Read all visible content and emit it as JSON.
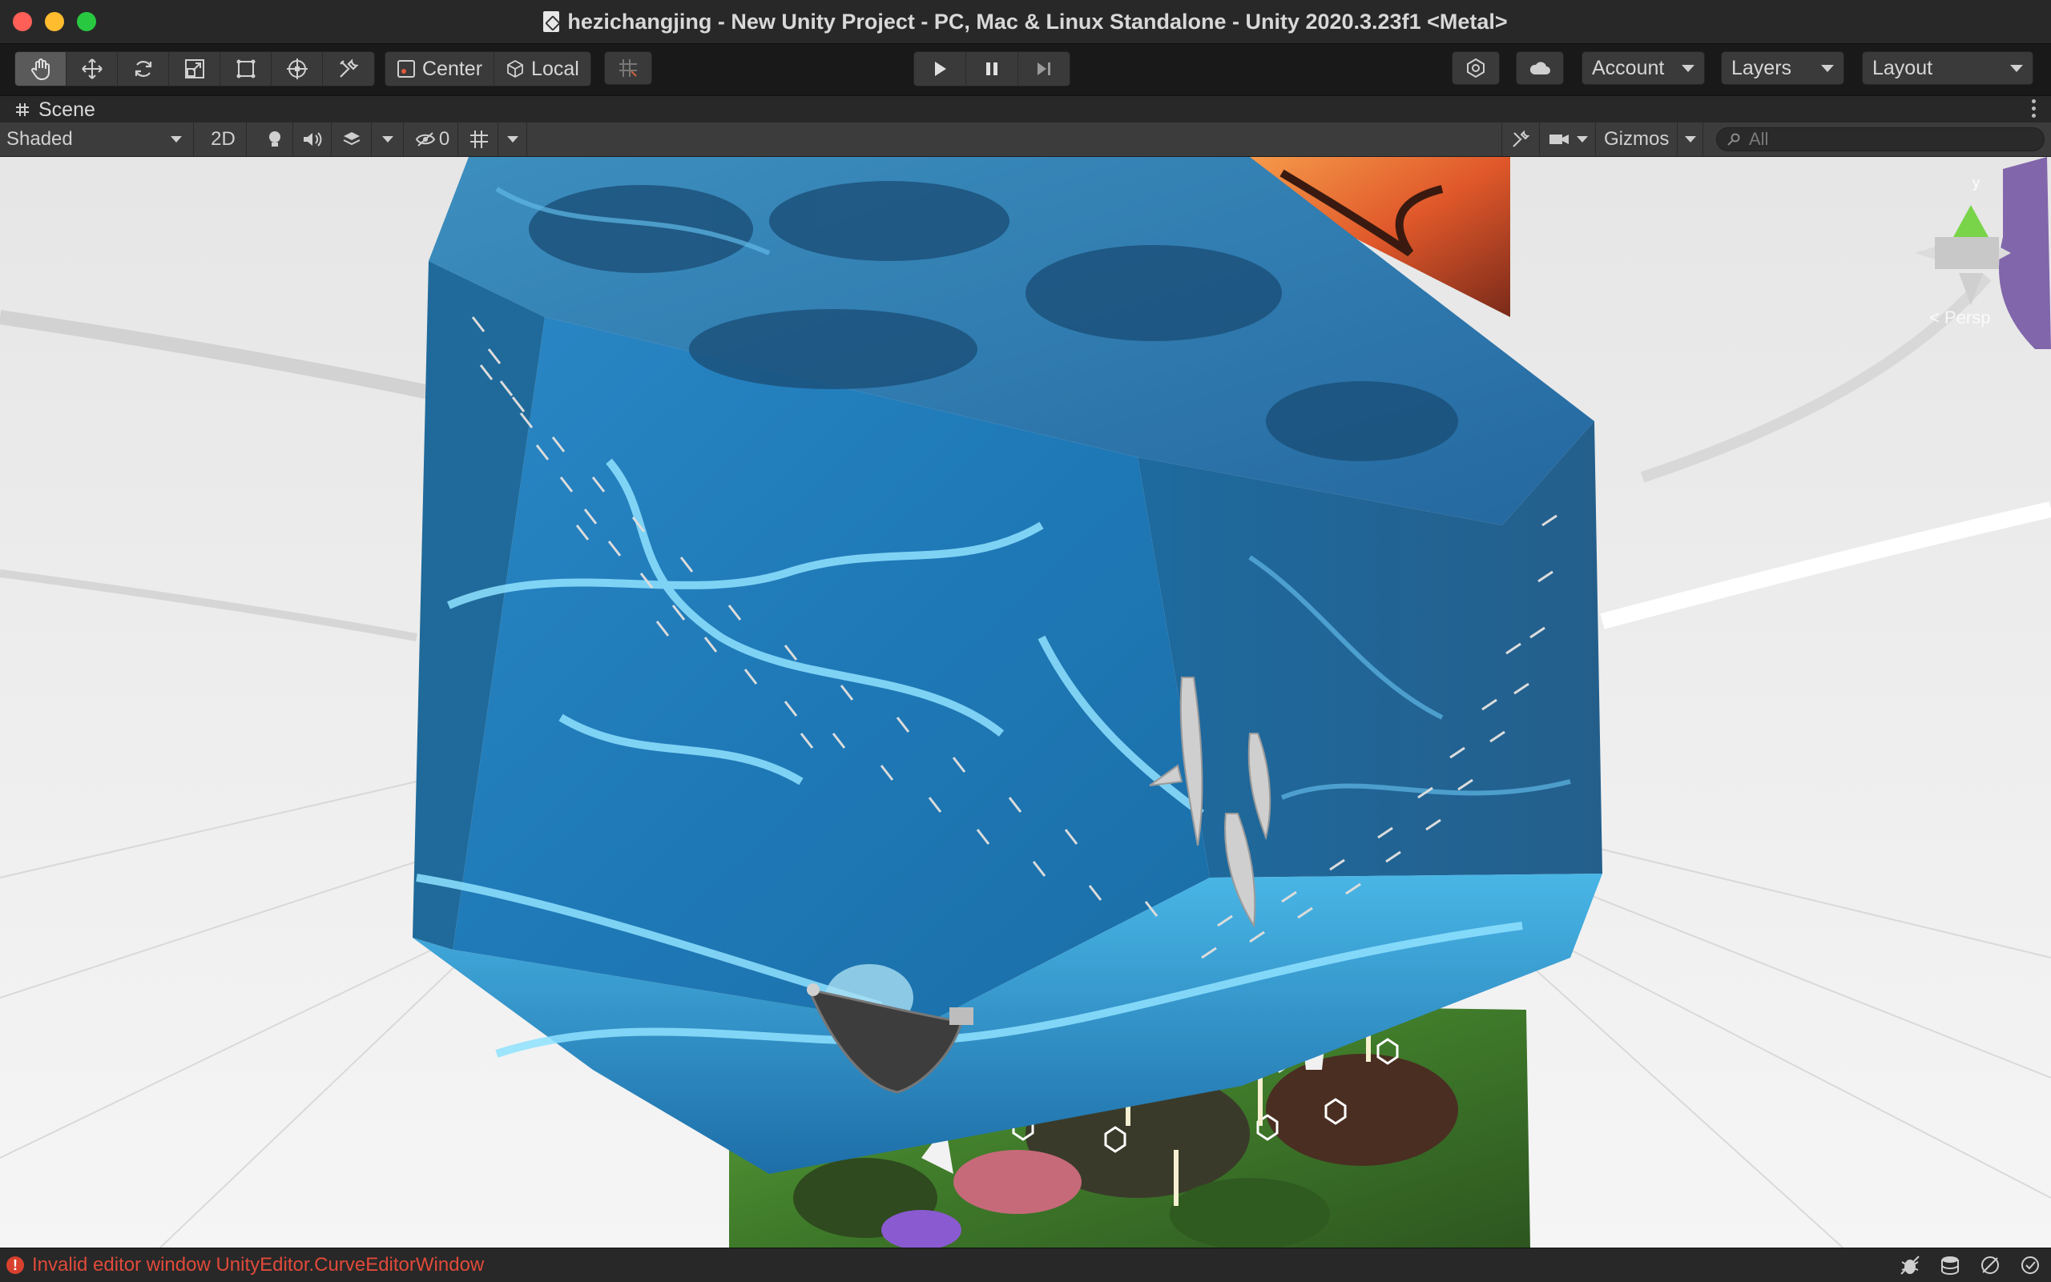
{
  "window": {
    "title": "hezichangjing - New Unity Project - PC, Mac & Linux Standalone - Unity 2020.3.23f1 <Metal>"
  },
  "toolbar": {
    "tools": [
      "hand-tool",
      "move-tool",
      "rotate-tool",
      "scale-tool",
      "rect-tool",
      "transform-tool",
      "custom-tool"
    ],
    "active_tool": "hand-tool",
    "pivot_label": "Center",
    "space_label": "Local",
    "account_label": "Account",
    "layers_label": "Layers",
    "layout_label": "Layout"
  },
  "scene_tab": {
    "label": "Scene"
  },
  "scene_toolbar": {
    "shading_mode": "Shaded",
    "mode_2d_label": "2D",
    "hidden_count": "0",
    "gizmos_label": "Gizmos",
    "search_placeholder": "All"
  },
  "orientation_gizmo": {
    "y_label": "y",
    "persp_label": "< Persp"
  },
  "status": {
    "message": "Invalid editor window UnityEditor.CurveEditorWindow",
    "message_color": "#e04a3a"
  },
  "colors": {
    "accent_play": "#d0d0d0",
    "water_dark": "#1b5d84",
    "water_light": "#4fc3f0",
    "foliage": "#4e8b2c"
  }
}
